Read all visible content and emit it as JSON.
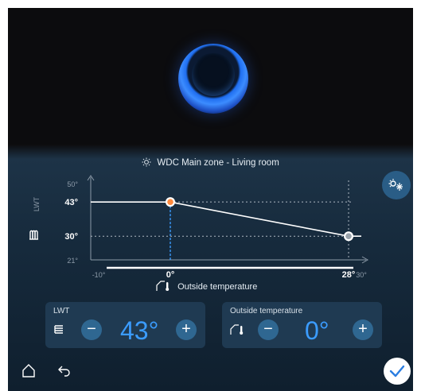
{
  "header": {
    "zone_label": "WDC Main zone -  Living room"
  },
  "chart_data": {
    "type": "line",
    "xlabel": "Outside temperature",
    "ylabel": "LWT",
    "x_ticks": [
      "-10°",
      "0°",
      "28°",
      "30°"
    ],
    "y_ticks": [
      "50°",
      "43°",
      "30°",
      "21°"
    ],
    "xlim": [
      -10,
      30
    ],
    "ylim": [
      21,
      50
    ],
    "series": [
      {
        "x": [
          -10,
          0,
          28,
          30
        ],
        "y": [
          43,
          43,
          30,
          30
        ]
      }
    ],
    "highlighted_points": [
      {
        "x": 0,
        "y": 43,
        "color": "#ff8a3d"
      },
      {
        "x": 28,
        "y": 30,
        "color": "#9aa3ab"
      }
    ]
  },
  "lwt_panel": {
    "title": "LWT",
    "value": "43°",
    "minus": "−",
    "plus": "+"
  },
  "outside_panel": {
    "title": "Outside temperature",
    "value": "0°",
    "minus": "−",
    "plus": "+"
  },
  "icons": {
    "mode": "heating-cooling-icon",
    "home": "home-icon",
    "back": "back-icon",
    "confirm": "check-icon"
  },
  "colors": {
    "accent": "#3b9cff",
    "highlight": "#ff8a3d",
    "button": "#2f6791"
  }
}
